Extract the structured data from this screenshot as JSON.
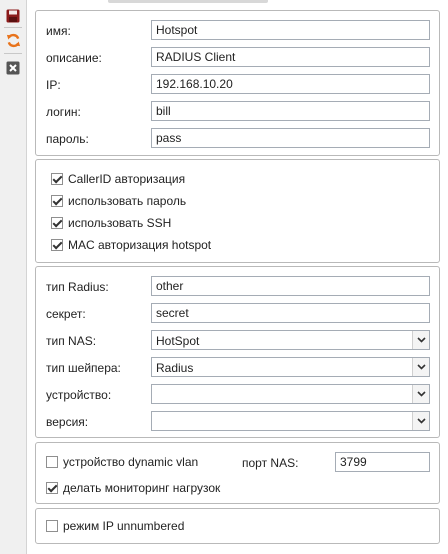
{
  "toolbar": {
    "save_icon": "floppy-disk-icon",
    "refresh_icon": "refresh-icon",
    "close_icon": "close-icon",
    "colors": {
      "save": "#8b1a1a",
      "refresh": "#e8731c",
      "close": "#555555"
    }
  },
  "general": {
    "name_label": "имя:",
    "name_value": "Hotspot",
    "description_label": "описание:",
    "description_value": "RADIUS Client",
    "ip_label": "IP:",
    "ip_value": "192.168.10.20",
    "login_label": "логин:",
    "login_value": "bill",
    "password_label": "пароль:",
    "password_value": "pass"
  },
  "auth": {
    "callerid": {
      "label": "CallerID авторизация",
      "checked": true
    },
    "use_password": {
      "label": "использовать пароль",
      "checked": true
    },
    "use_ssh": {
      "label": "использовать SSH",
      "checked": true
    },
    "mac_hotspot": {
      "label": "MAC авторизация hotspot",
      "checked": true
    }
  },
  "radius": {
    "type_label": "тип Radius:",
    "type_value": "other",
    "secret_label": "секрет:",
    "secret_value": "secret",
    "nas_type_label": "тип NAS:",
    "nas_type_value": "HotSpot",
    "shaper_label": "тип шейпера:",
    "shaper_value": "Radius",
    "device_label": "устройство:",
    "device_value": "",
    "version_label": "версия:",
    "version_value": ""
  },
  "options": {
    "dynamic_vlan": {
      "label": "устройство dynamic vlan",
      "checked": false
    },
    "nas_port_label": "порт NAS:",
    "nas_port_value": "3799",
    "load_monitoring": {
      "label": "делать мониторинг нагрузок",
      "checked": true
    }
  },
  "unnumbered": {
    "ip_unnumbered": {
      "label": "режим IP unnumbered",
      "checked": false
    }
  }
}
